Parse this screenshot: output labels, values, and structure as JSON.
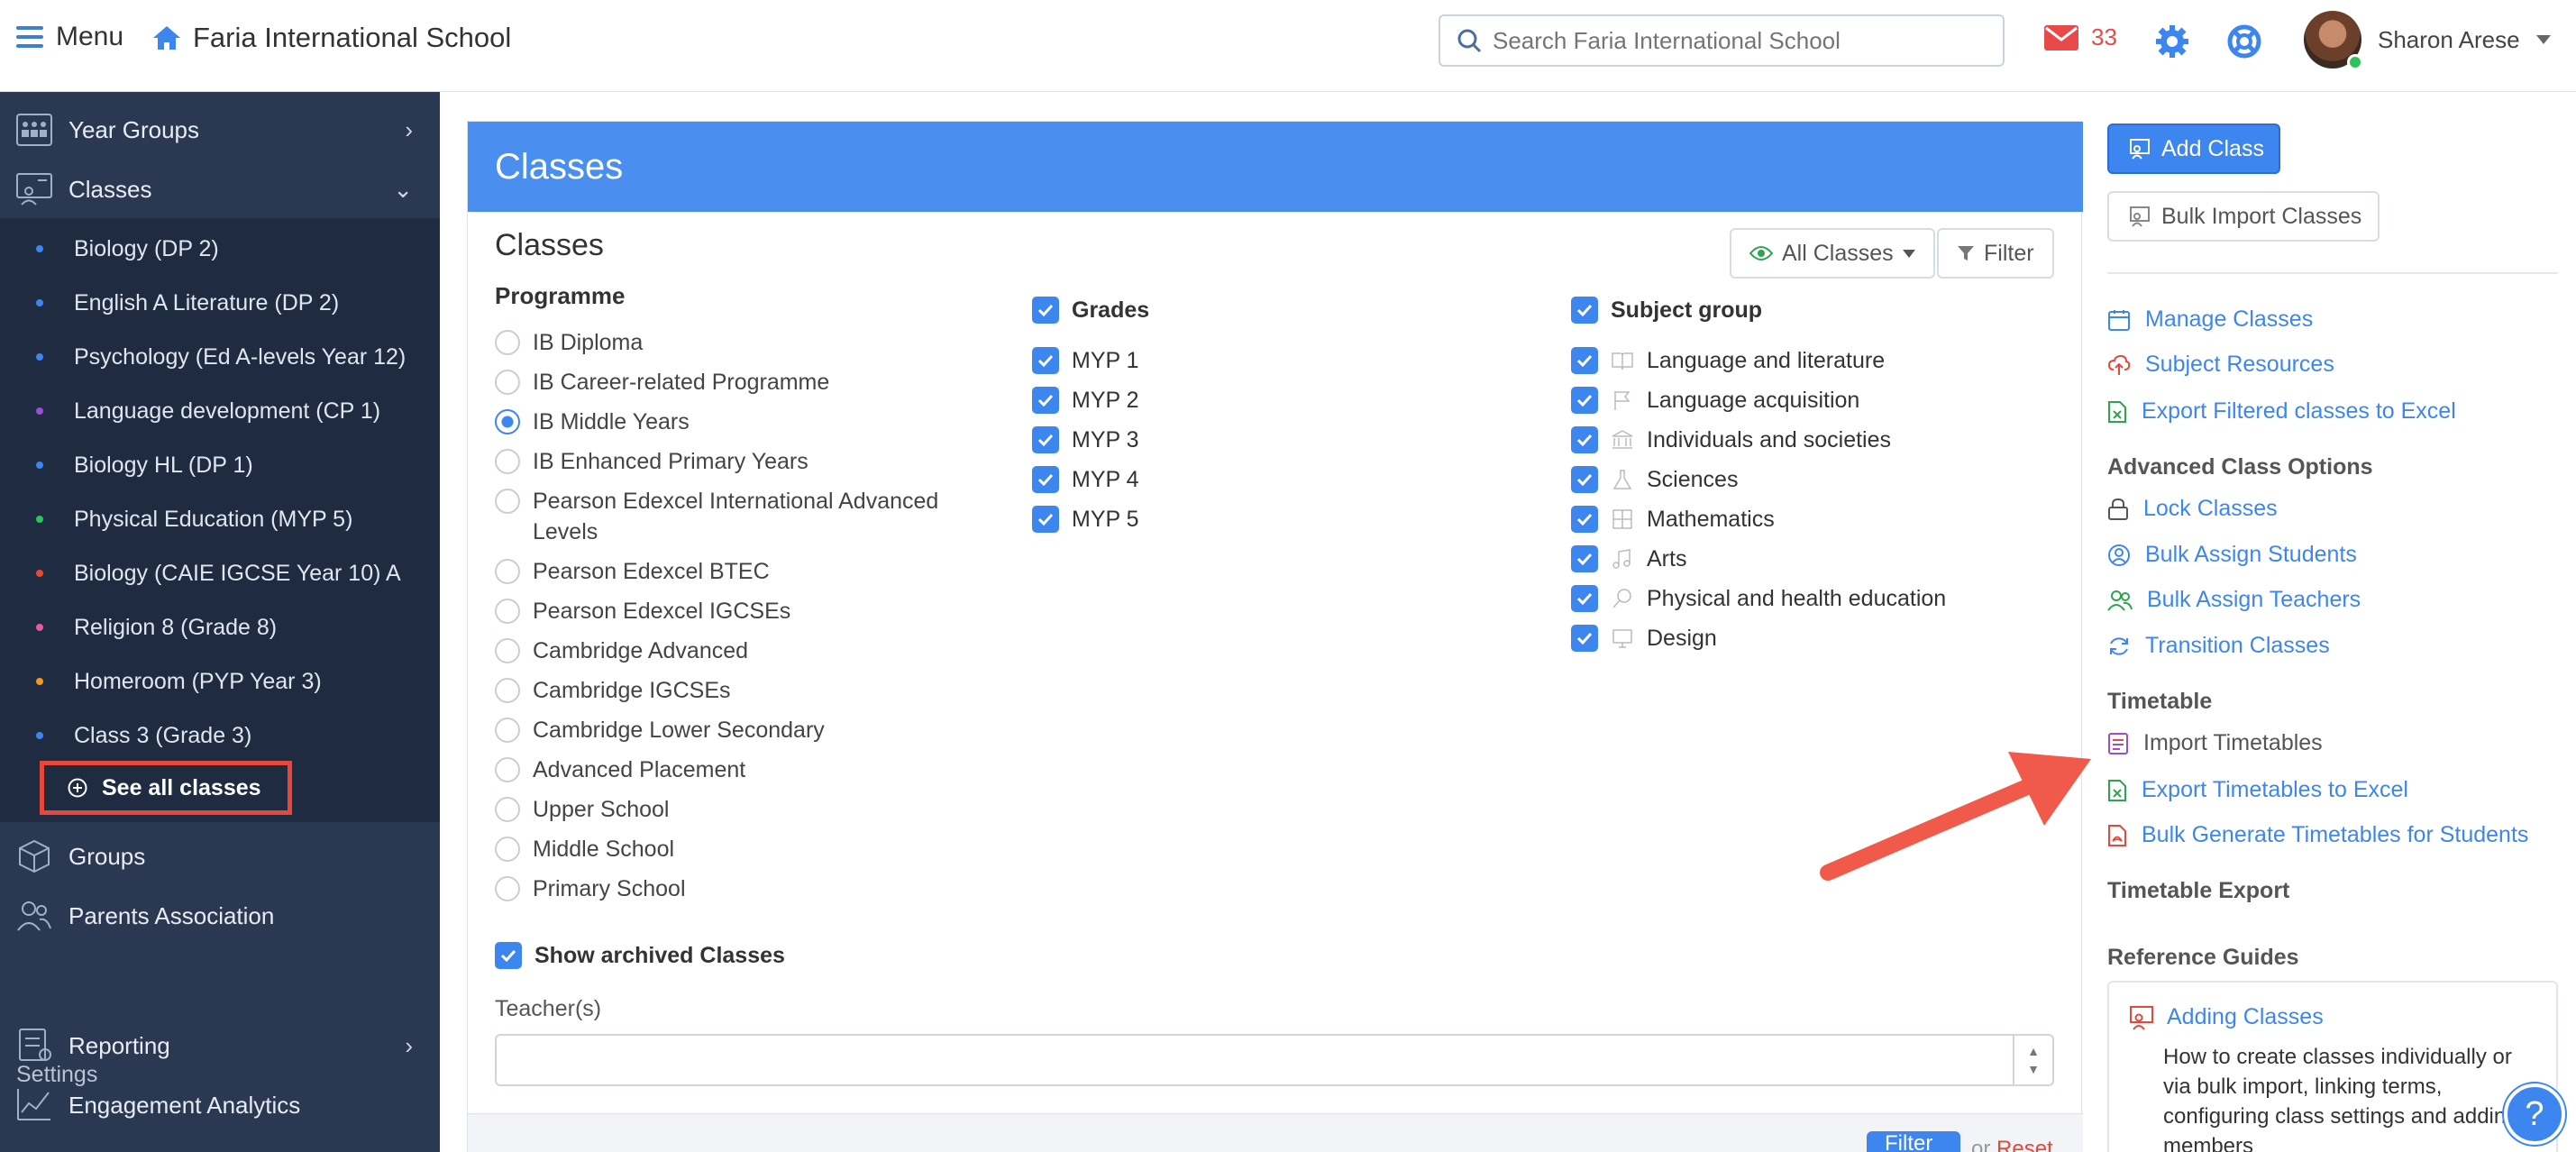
{
  "topbar": {
    "menu_label": "Menu",
    "school_name": "Faria International School",
    "search_placeholder": "Search Faria International School",
    "mail_count": "33",
    "user_name": "Sharon Arese"
  },
  "sidebar": {
    "sections": [
      {
        "label": "Year Groups",
        "icon": "year-groups-icon"
      },
      {
        "label": "Classes",
        "icon": "classes-icon"
      }
    ],
    "classes": [
      {
        "label": "Biology (DP 2)",
        "dot": "#3d86f0"
      },
      {
        "label": "English A Literature (DP 2)",
        "dot": "#3d86f0"
      },
      {
        "label": "Psychology (Ed A-levels Year 12)",
        "dot": "#3d86f0"
      },
      {
        "label": "Language development (CP 1)",
        "dot": "#9b4fd0"
      },
      {
        "label": "Biology HL (DP 1)",
        "dot": "#3d86f0"
      },
      {
        "label": "Physical Education (MYP 5)",
        "dot": "#2ec25a"
      },
      {
        "label": "Biology (CAIE IGCSE Year 10) A",
        "dot": "#e8473a"
      },
      {
        "label": "Religion 8 (Grade 8)",
        "dot": "#e85aa0"
      },
      {
        "label": "Homeroom (PYP Year 3)",
        "dot": "#f39a1e"
      },
      {
        "label": "Class 3 (Grade 3)",
        "dot": "#3d86f0"
      }
    ],
    "see_all_label": "See all classes",
    "lower_items": [
      {
        "label": "Groups",
        "icon": "cube-icon"
      },
      {
        "label": "Parents Association",
        "icon": "people-icon"
      }
    ],
    "settings_label": "Settings",
    "settings_items": [
      {
        "label": "Reporting",
        "icon": "reporting-icon"
      },
      {
        "label": "Engagement Analytics",
        "icon": "analytics-icon"
      }
    ]
  },
  "panel": {
    "header": "Classes",
    "title": "Classes",
    "all_classes_label": "All Classes",
    "filter_label": "Filter",
    "programme_title": "Programme",
    "programmes": [
      {
        "label": "IB Diploma",
        "selected": false
      },
      {
        "label": "IB Career-related Programme",
        "selected": false
      },
      {
        "label": "IB Middle Years",
        "selected": true
      },
      {
        "label": "IB Enhanced Primary Years",
        "selected": false
      },
      {
        "label": "Pearson Edexcel International Advanced Levels",
        "selected": false
      },
      {
        "label": "Pearson Edexcel BTEC",
        "selected": false
      },
      {
        "label": "Pearson Edexcel IGCSEs",
        "selected": false
      },
      {
        "label": "Cambridge Advanced",
        "selected": false
      },
      {
        "label": "Cambridge IGCSEs",
        "selected": false
      },
      {
        "label": "Cambridge Lower Secondary",
        "selected": false
      },
      {
        "label": "Advanced Placement",
        "selected": false
      },
      {
        "label": "Upper School",
        "selected": false
      },
      {
        "label": "Middle School",
        "selected": false
      },
      {
        "label": "Primary School",
        "selected": false
      }
    ],
    "grades_title": "Grades",
    "grades": [
      "MYP 1",
      "MYP 2",
      "MYP 3",
      "MYP 4",
      "MYP 5"
    ],
    "subject_title": "Subject group",
    "subjects": [
      "Language and literature",
      "Language acquisition",
      "Individuals and societies",
      "Sciences",
      "Mathematics",
      "Arts",
      "Physical and health education",
      "Design"
    ],
    "show_archived_label": "Show archived Classes",
    "teacher_label": "Teacher(s)",
    "teacher_value": "",
    "footer_filter": "Filter",
    "footer_or": "or",
    "footer_reset": "Reset"
  },
  "right": {
    "add_class_label": "Add Class",
    "bulk_import_label": "Bulk Import Classes",
    "links": [
      {
        "label": "Manage Classes",
        "icon": "calendar-icon",
        "color": "#3d86f0"
      },
      {
        "label": "Subject Resources",
        "icon": "cloud-icon",
        "color": "#e8473a"
      },
      {
        "label": "Export Filtered classes to Excel",
        "icon": "excel-icon",
        "color": "#2ea44f"
      }
    ],
    "advanced_title": "Advanced Class Options",
    "advanced_links": [
      {
        "label": "Lock Classes",
        "icon": "lock-icon",
        "color": "#555"
      },
      {
        "label": "Bulk Assign Students",
        "icon": "user-icon",
        "color": "#3d86f0"
      },
      {
        "label": "Bulk Assign Teachers",
        "icon": "users-icon",
        "color": "#2ea44f"
      },
      {
        "label": "Transition Classes",
        "icon": "refresh-icon",
        "color": "#3d86f0"
      }
    ],
    "timetable_title": "Timetable",
    "timetable_links": [
      {
        "label": "Import Timetables",
        "icon": "import-icon",
        "color": "#9b4fd0"
      },
      {
        "label": "Export Timetables to Excel",
        "icon": "excel-icon",
        "color": "#2ea44f"
      },
      {
        "label": "Bulk Generate Timetables for Students",
        "icon": "pdf-icon",
        "color": "#e8473a"
      }
    ],
    "timetable_export_title": "Timetable Export",
    "reference_title": "Reference Guides",
    "reference_card_title": "Adding Classes",
    "reference_card_desc": "How to create classes individually or via bulk import, linking terms, configuring class settings and adding members"
  },
  "colors": {
    "accent": "#3d86f0",
    "sidebar_bg": "#2a3851",
    "highlight_box": "#e8473a",
    "arrow": "#f15a4a"
  }
}
